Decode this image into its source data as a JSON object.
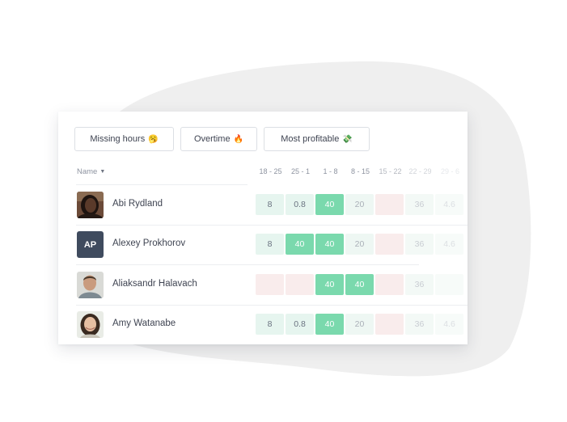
{
  "filters": [
    {
      "label": "Missing hours",
      "emoji": "🥱"
    },
    {
      "label": "Overtime",
      "emoji": "🔥"
    },
    {
      "label": "Most profitable",
      "emoji": "💸"
    }
  ],
  "table": {
    "name_header": "Name",
    "weeks": [
      "18 - 25",
      "25 - 1",
      "1 - 8",
      "8 - 15",
      "15 - 22",
      "22 - 29",
      "29 - 6"
    ],
    "rows": [
      {
        "name": "Abi Rydland",
        "avatar": "photo-avatar",
        "cells": [
          {
            "value": "8",
            "status": "light-green"
          },
          {
            "value": "0.8",
            "status": "light-green"
          },
          {
            "value": "40",
            "status": "green"
          },
          {
            "value": "20",
            "status": "pale-green"
          },
          {
            "value": "",
            "status": "pale-red"
          },
          {
            "value": "36",
            "status": "faded"
          },
          {
            "value": "4.6",
            "status": "very-faded"
          }
        ]
      },
      {
        "name": "Alexey Prokhorov",
        "avatar_initials": "AP",
        "cells": [
          {
            "value": "8",
            "status": "light-green"
          },
          {
            "value": "40",
            "status": "green"
          },
          {
            "value": "40",
            "status": "green"
          },
          {
            "value": "20",
            "status": "pale-green"
          },
          {
            "value": "",
            "status": "pale-red"
          },
          {
            "value": "36",
            "status": "faded"
          },
          {
            "value": "4.6",
            "status": "very-faded"
          }
        ]
      },
      {
        "name": "Aliaksandr Halavach",
        "avatar": "photo-avatar",
        "cells": [
          {
            "value": "",
            "status": "pale-red"
          },
          {
            "value": "",
            "status": "pale-red"
          },
          {
            "value": "40",
            "status": "green"
          },
          {
            "value": "40",
            "status": "green"
          },
          {
            "value": "",
            "status": "pale-red"
          },
          {
            "value": "36",
            "status": "faded"
          },
          {
            "value": "",
            "status": "very-faded"
          }
        ]
      },
      {
        "name": "Amy Watanabe",
        "avatar": "photo-avatar",
        "cells": [
          {
            "value": "8",
            "status": "light-green"
          },
          {
            "value": "0.8",
            "status": "light-green"
          },
          {
            "value": "40",
            "status": "green"
          },
          {
            "value": "20",
            "status": "pale-green"
          },
          {
            "value": "",
            "status": "pale-red"
          },
          {
            "value": "36",
            "status": "faded"
          },
          {
            "value": "4.6",
            "status": "very-faded"
          }
        ]
      }
    ]
  },
  "status_colors": {
    "light-green": {
      "bg": "#e6f5ef",
      "fg": "#6a7280"
    },
    "green": {
      "bg": "#7ad9ad",
      "fg": "#ffffff"
    },
    "pale-green": {
      "bg": "#eef7f3",
      "fg": "#aab0b8"
    },
    "pale-red": {
      "bg": "#f9ecec",
      "fg": "#b8a8a8"
    },
    "faded": {
      "bg": "#f3f9f6",
      "fg": "#c8ccd2"
    },
    "very-faded": {
      "bg": "#f7fbf9",
      "fg": "#dcdfe3"
    }
  },
  "colors": {
    "blob": "#efefef",
    "accent_green": "#7ad9ad",
    "avatar_initials_bg": "#3f4b5e"
  }
}
